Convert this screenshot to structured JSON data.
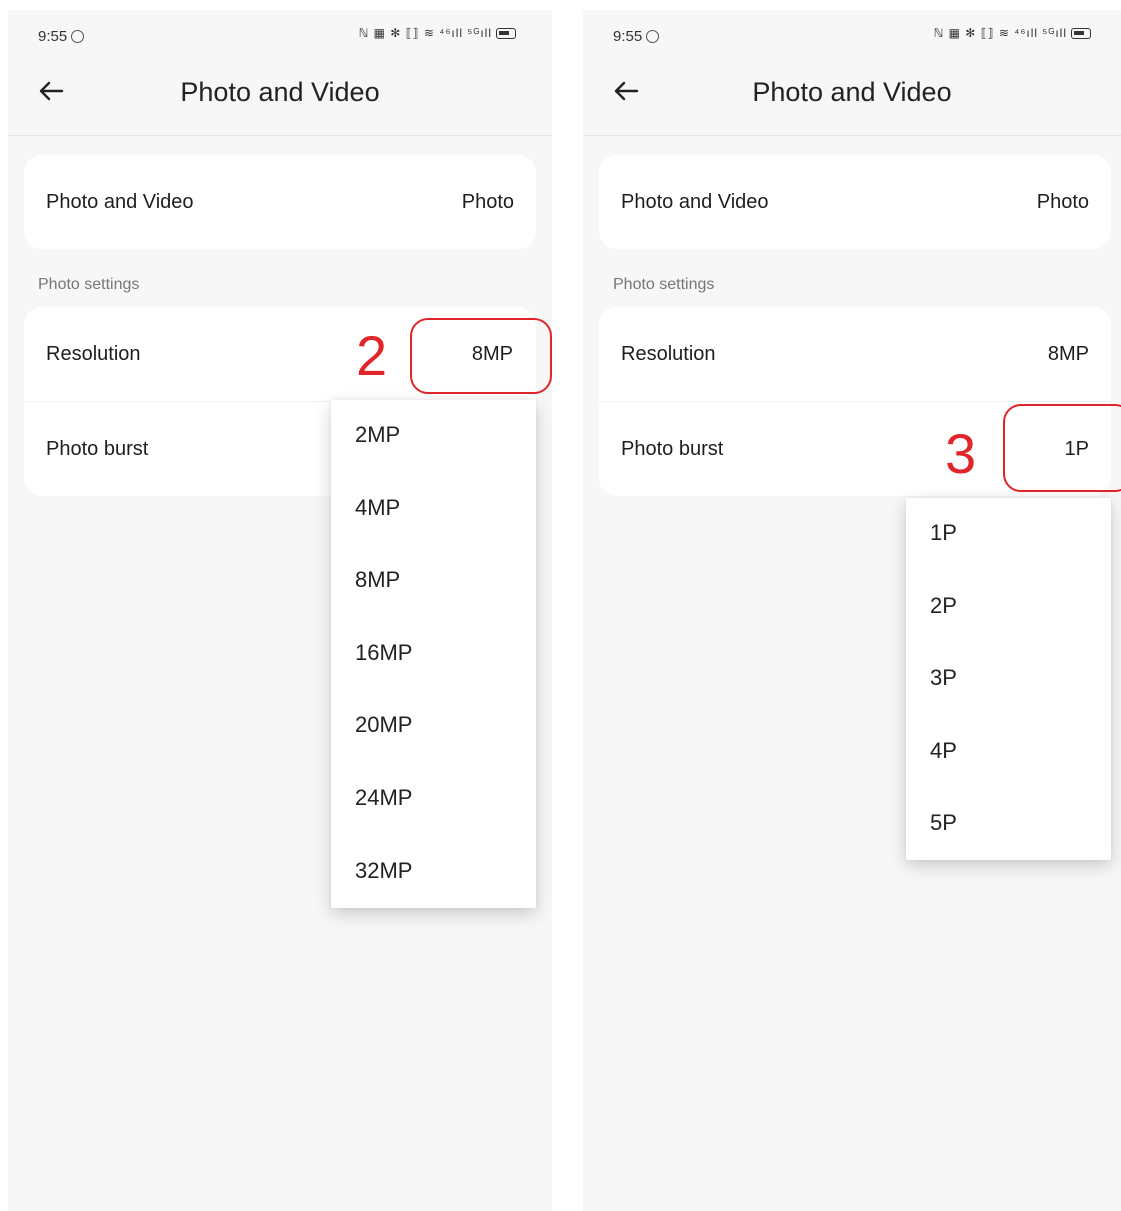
{
  "colors": {
    "screen_bg": "#f7f7f7",
    "card_bg": "#ffffff",
    "annotation_red": "#e0262a"
  },
  "screens": [
    {
      "status_time": "9:55",
      "status_icons_text": "ℕ ▦ ✻ ⟦⟧ ≋ ⁴⁶ıll ⁵ᴳıll",
      "title": "Photo and Video",
      "mode_row": {
        "label": "Photo and Video",
        "value": "Photo"
      },
      "section_label": "Photo settings",
      "resolution_row": {
        "label": "Resolution",
        "value": "8MP"
      },
      "burst_row": {
        "label": "Photo burst",
        "value": ""
      },
      "callout_number": "2",
      "dropdown_options": [
        "2MP",
        "4MP",
        "8MP",
        "16MP",
        "20MP",
        "24MP",
        "32MP"
      ]
    },
    {
      "status_time": "9:55",
      "status_icons_text": "ℕ ▦ ✻ ⟦⟧ ≋ ⁴⁶ıll ⁵ᴳıll",
      "title": "Photo and Video",
      "mode_row": {
        "label": "Photo and Video",
        "value": "Photo"
      },
      "section_label": "Photo settings",
      "resolution_row": {
        "label": "Resolution",
        "value": "8MP"
      },
      "burst_row": {
        "label": "Photo burst",
        "value": "1P"
      },
      "callout_number": "3",
      "dropdown_options": [
        "1P",
        "2P",
        "3P",
        "4P",
        "5P"
      ]
    }
  ]
}
